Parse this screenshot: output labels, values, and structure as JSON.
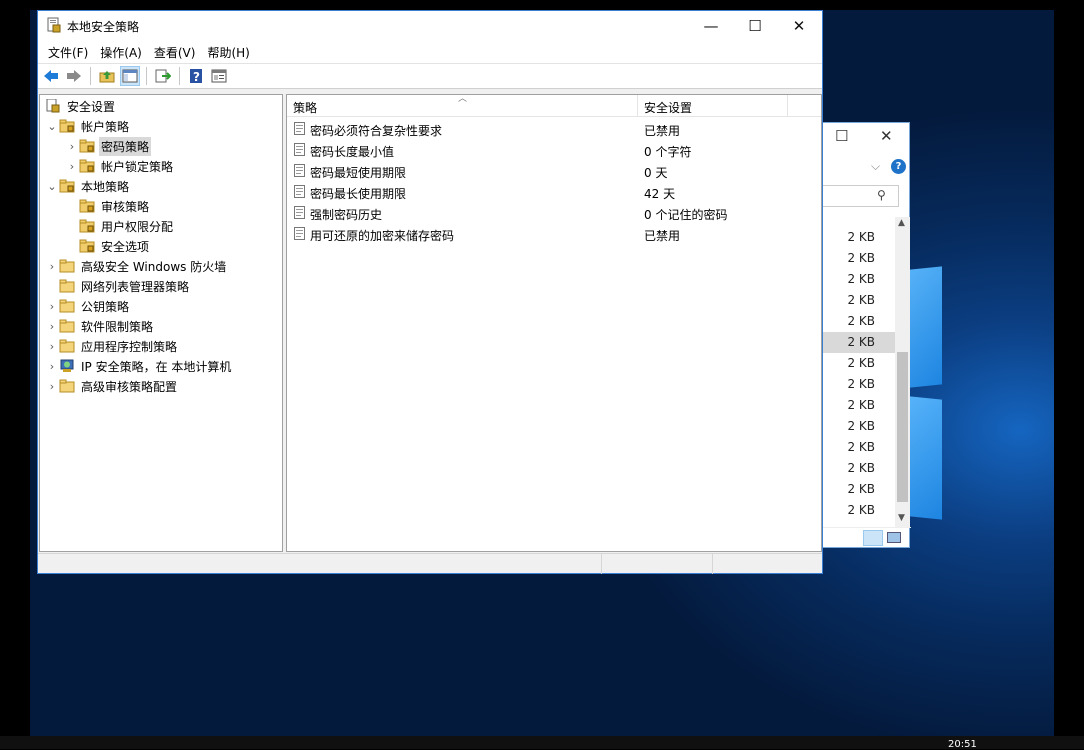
{
  "window": {
    "title": "本地安全策略",
    "minimize_glyph": "—",
    "maximize_glyph": "☐",
    "close_glyph": "✕"
  },
  "menu": [
    {
      "label": "文件(F)"
    },
    {
      "label": "操作(A)"
    },
    {
      "label": "查看(V)"
    },
    {
      "label": "帮助(H)"
    }
  ],
  "toolbar": {
    "icons": [
      "back-icon",
      "forward-icon",
      "up-folder-icon",
      "show-hide-tree-icon",
      "export-list-icon",
      "help-icon",
      "properties-icon"
    ]
  },
  "tree": {
    "root": "安全设置",
    "nodes": [
      {
        "label": "帐户策略",
        "expanded": true
      },
      {
        "label": "密码策略",
        "selected": true
      },
      {
        "label": "帐户锁定策略"
      },
      {
        "label": "本地策略",
        "expanded": true
      },
      {
        "label": "审核策略"
      },
      {
        "label": "用户权限分配"
      },
      {
        "label": "安全选项"
      },
      {
        "label": "高级安全 Windows 防火墙"
      },
      {
        "label": "网络列表管理器策略"
      },
      {
        "label": "公钥策略"
      },
      {
        "label": "软件限制策略"
      },
      {
        "label": "应用程序控制策略"
      },
      {
        "label": "IP 安全策略，在 本地计算机"
      },
      {
        "label": "高级审核策略配置"
      }
    ]
  },
  "list": {
    "columns": [
      "策略",
      "安全设置"
    ],
    "rows": [
      {
        "policy": "密码必须符合复杂性要求",
        "setting": "已禁用"
      },
      {
        "policy": "密码长度最小值",
        "setting": "0 个字符"
      },
      {
        "policy": "密码最短使用期限",
        "setting": "0 天"
      },
      {
        "policy": "密码最长使用期限",
        "setting": "42 天"
      },
      {
        "policy": "强制密码历史",
        "setting": "0 个记住的密码"
      },
      {
        "policy": "用可还原的加密来储存密码",
        "setting": "已禁用"
      }
    ]
  },
  "background_window": {
    "file_sizes": [
      "2 KB",
      "2 KB",
      "2 KB",
      "2 KB",
      "2 KB",
      "2 KB",
      "2 KB",
      "2 KB",
      "2 KB",
      "2 KB",
      "2 KB",
      "2 KB",
      "2 KB",
      "2 KB"
    ],
    "selected_index": 5
  },
  "taskbar": {
    "clock": "20:51"
  },
  "colors": {
    "window_border": "#3b7fd4",
    "selection": "#d9d9d9",
    "desktop": "#062a5c"
  }
}
